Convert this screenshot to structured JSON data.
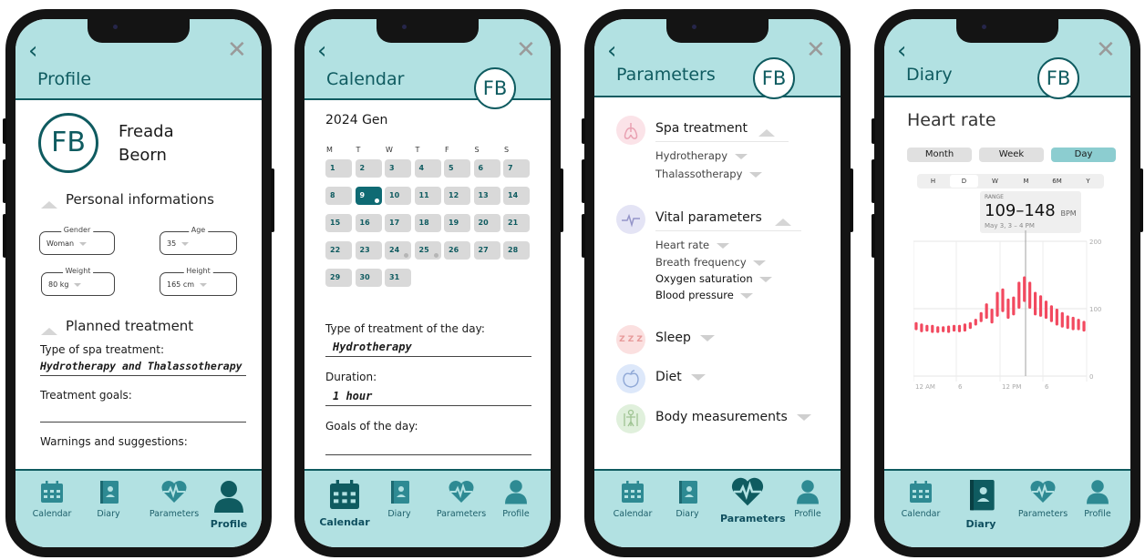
{
  "screens": {
    "profile": {
      "title": "Profile",
      "avatar_initials": "FB",
      "first_name": "Freada",
      "last_name": "Beorn",
      "personal_section": "Personal informations",
      "fields": [
        {
          "label": "Gender",
          "value": "Woman"
        },
        {
          "label": "Age",
          "value": "35"
        },
        {
          "label": "Weight",
          "value": "80 kg"
        },
        {
          "label": "Height",
          "value": "165 cm"
        }
      ],
      "planned_section": "Planned treatment",
      "spa_type_label": "Type of spa treatment:",
      "spa_type_value": "Hydrotherapy and Thalassotherapy",
      "goals_label": "Treatment goals:",
      "warnings_label": "Warnings and suggestions:"
    },
    "calendar": {
      "title": "Calendar",
      "badge": "FB",
      "month": "2024 Gen",
      "weekdays": [
        "M",
        "T",
        "W",
        "T",
        "F",
        "S",
        "S"
      ],
      "days": [
        "1",
        "2",
        "3",
        "4",
        "5",
        "6",
        "7",
        "8",
        "9",
        "10",
        "11",
        "12",
        "13",
        "14",
        "15",
        "16",
        "17",
        "18",
        "19",
        "20",
        "21",
        "22",
        "23",
        "24",
        "25",
        "26",
        "27",
        "28",
        "29",
        "30",
        "31"
      ],
      "selected_day": "9",
      "treatment_label": "Type of treatment of the day:",
      "treatment_value": "Hydrotherapy",
      "duration_label": "Duration:",
      "duration_value": "1 hour",
      "goals_label": "Goals of the day:"
    },
    "parameters": {
      "title": "Parameters",
      "badge": "FB",
      "spa_group": "Spa treatment",
      "spa_items": [
        "Hydrotherapy",
        "Thalassotherapy"
      ],
      "vital_group": "Vital parameters",
      "vital_items": [
        "Heart rate",
        "Breath frequency",
        "Oxygen saturation",
        "Blood pressure"
      ],
      "sleep": "Sleep",
      "diet": "Diet",
      "body": "Body measurements",
      "sleep_icon_text": "Z Z Z"
    },
    "diary": {
      "title": "Diary",
      "badge": "FB",
      "heading": "Heart rate",
      "segments": [
        "Month",
        "Week",
        "Day"
      ],
      "ranges": [
        "H",
        "D",
        "W",
        "M",
        "6M",
        "Y"
      ],
      "range_label": "RANGE",
      "range_value": "109–148",
      "range_unit": "BPM",
      "range_date": "May 3, 3 – 4 PM",
      "y_labels": [
        "200",
        "100",
        "0"
      ],
      "x_labels": [
        "12 AM",
        "6",
        "12 PM",
        "6"
      ]
    }
  },
  "tabs": {
    "calendar": "Calendar",
    "diary": "Diary",
    "parameters": "Parameters",
    "profile": "Profile"
  },
  "colors": {
    "header": "#b2e1e2",
    "accent": "#0f5b60",
    "chart_bar": "#f2495f"
  },
  "chart_data": {
    "type": "bar",
    "title": "Heart rate",
    "ylabel": "",
    "ylim": [
      0,
      200
    ],
    "x_ticks": [
      "12 AM",
      "6",
      "12 PM",
      "6"
    ],
    "series": [
      {
        "values": [
          [
            68,
            80
          ],
          [
            65,
            78
          ],
          [
            66,
            76
          ],
          [
            64,
            76
          ],
          [
            64,
            74
          ],
          [
            65,
            74
          ],
          [
            64,
            75
          ],
          [
            66,
            76
          ],
          [
            65,
            76
          ],
          [
            66,
            78
          ],
          [
            70,
            80
          ],
          [
            75,
            85
          ],
          [
            80,
            95
          ],
          [
            85,
            108
          ],
          [
            78,
            100
          ],
          [
            88,
            125
          ],
          [
            95,
            130
          ],
          [
            85,
            115
          ],
          [
            90,
            118
          ],
          [
            100,
            140
          ],
          [
            110,
            148
          ],
          [
            100,
            140
          ],
          [
            90,
            125
          ],
          [
            88,
            120
          ],
          [
            85,
            112
          ],
          [
            80,
            105
          ],
          [
            75,
            100
          ],
          [
            72,
            95
          ],
          [
            70,
            90
          ],
          [
            68,
            88
          ],
          [
            68,
            85
          ],
          [
            66,
            82
          ]
        ]
      }
    ]
  }
}
